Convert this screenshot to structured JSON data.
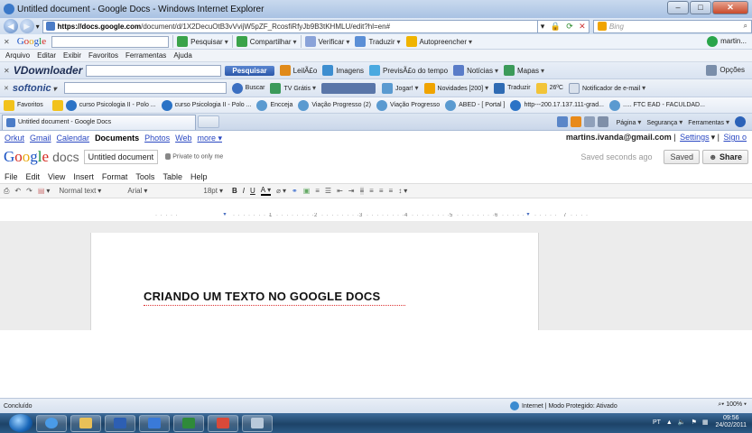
{
  "window": {
    "title": "Untitled document - Google Docs - Windows Internet Explorer",
    "controls": [
      "–",
      "□",
      "✕"
    ]
  },
  "address": {
    "url_host": "https://docs.google.com",
    "url_path": "/document/d/1X2DecuOtB3vVvijW5pZF_RcosfiRfyJb9B3tKHMLU/edit?hl=en#",
    "search_placeholder": "Bing"
  },
  "google_toolbar": {
    "logo": [
      "G",
      "o",
      "o",
      "g",
      "l",
      "e"
    ],
    "items": [
      "Pesquisar",
      "Compartilhar",
      "Verificar",
      "Traduzir",
      "Autopreencher"
    ],
    "user": "martin..."
  },
  "menu": [
    "Arquivo",
    "Editar",
    "Exibir",
    "Favoritos",
    "Ferramentas",
    "Ajuda"
  ],
  "vdownloader": {
    "logo": "VDownloader",
    "search_button": "Pesquisar",
    "items": [
      "LeilÃ£o",
      "Imagens",
      "PrevisÃ£o do tempo",
      "Notícias",
      "Mapas"
    ],
    "options": "Opções"
  },
  "softonic": {
    "logo": "softonic",
    "items": [
      "Buscar",
      "TV Grátis",
      "Jogar!",
      "Novidades [200]",
      "Traduzir",
      "26ºC",
      "Notificador de e-mail"
    ]
  },
  "favorites": {
    "label": "Favoritos",
    "items": [
      "curso Psicologia II - Polo ...",
      "curso Psicologia II - Polo ...",
      "Encceja",
      "Viação Progresso (2)",
      "Viação Progresso",
      "ABED - [ Portal ]",
      "http---200.17.137.111-grad...",
      "..... FTC EAD - FACULDAD..."
    ]
  },
  "tabs": {
    "active": "Untitled document - Google Docs",
    "commands": [
      "Página",
      "Segurança",
      "Ferramentas"
    ]
  },
  "gbar": {
    "links": [
      "Orkut",
      "Gmail",
      "Calendar",
      "Documents",
      "Photos",
      "Web",
      "more ▾"
    ],
    "email": "martins.ivanda@gmail.com",
    "settings": "Settings",
    "signout": "Sign o"
  },
  "doc_header": {
    "logo": [
      "G",
      "o",
      "o",
      "g",
      "l",
      "e"
    ],
    "product": "docs",
    "title": "Untitled document",
    "private": "Private to only me",
    "saved_status": "Saved seconds ago",
    "saved_button": "Saved",
    "share_button": "Share"
  },
  "doc_menu": [
    "File",
    "Edit",
    "View",
    "Insert",
    "Format",
    "Tools",
    "Table",
    "Help"
  ],
  "format_bar": {
    "style": "Normal text",
    "font": "Arial",
    "size": "18pt",
    "buttons": [
      "B",
      "I",
      "U",
      "A",
      "⌀"
    ]
  },
  "ruler": {
    "numbers": [
      "1",
      "2",
      "3",
      "4",
      "5",
      "6",
      "7"
    ]
  },
  "document": {
    "body_text": "CRIANDO UM TEXTO NO GOOGLE DOCS"
  },
  "status": {
    "left": "Concluído",
    "zone": "Internet | Modo Protegido: Ativado",
    "zoom": "100%"
  },
  "taskbar": {
    "lang": "PT",
    "time": "09:56",
    "date": "24/02/2011"
  },
  "colors": {
    "link_blue": "#2a48c2",
    "google_blue": "#1a53c4",
    "google_red": "#d62a20",
    "google_yellow": "#e8a80c",
    "google_green": "#15903b"
  }
}
